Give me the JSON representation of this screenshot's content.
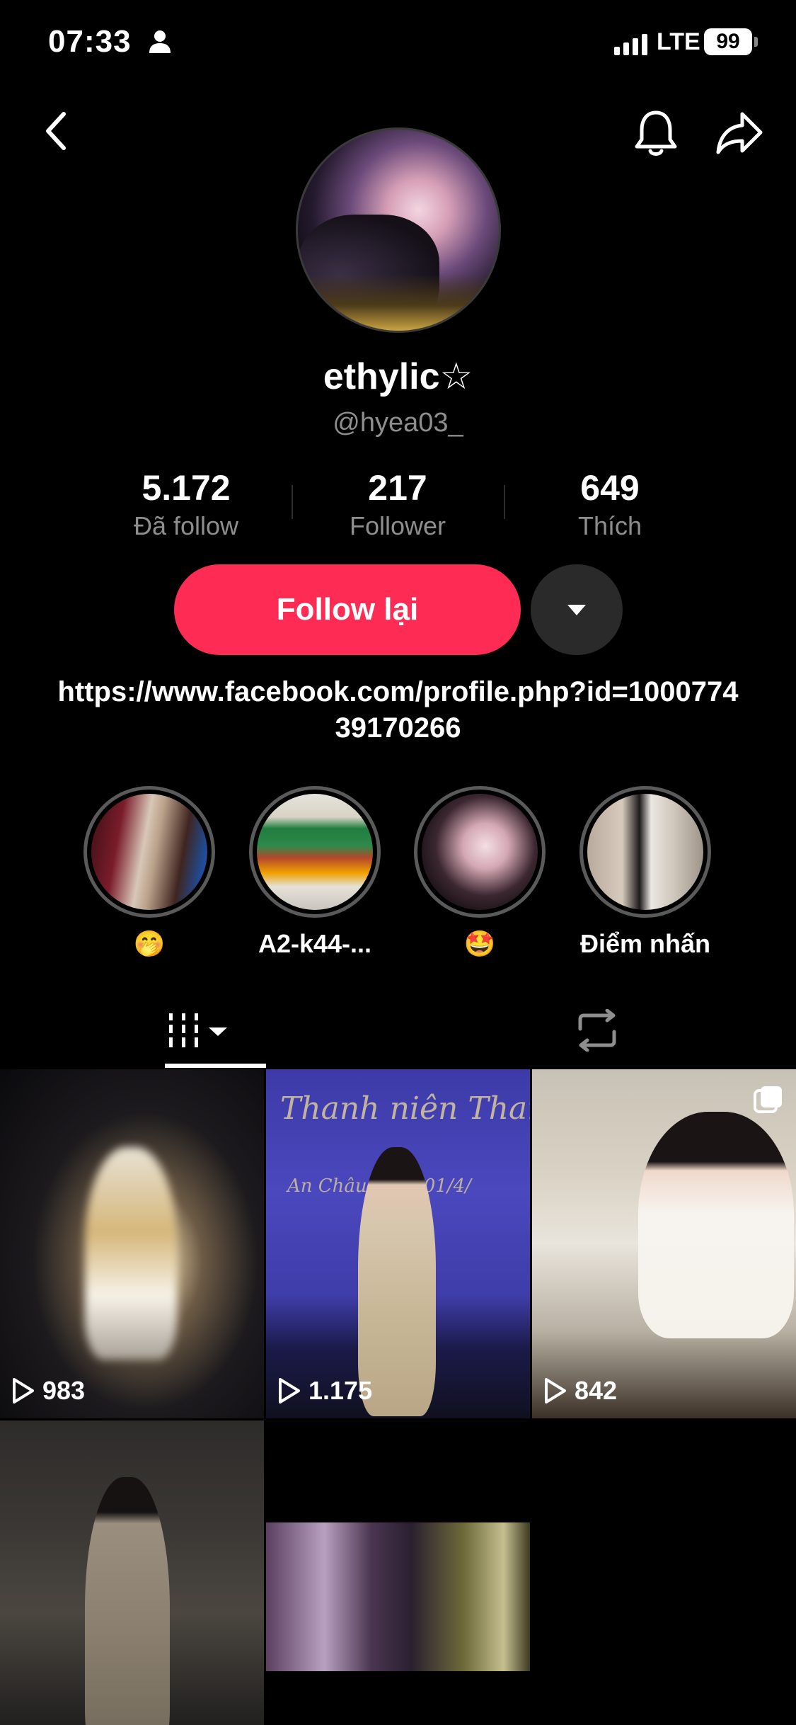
{
  "status_bar": {
    "time": "07:33",
    "network": "LTE",
    "battery": "99"
  },
  "nav": {
    "back_icon": "chevron-left-icon",
    "notification_icon": "bell-icon",
    "share_icon": "share-arrow-icon"
  },
  "profile": {
    "display_name": "ethylic☆",
    "username": "@hyea03_",
    "stats": [
      {
        "value": "5.172",
        "label": "Đã follow"
      },
      {
        "value": "217",
        "label": "Follower"
      },
      {
        "value": "649",
        "label": "Thích"
      }
    ],
    "follow_button": "Follow lại",
    "bio_link": "https://www.facebook.com/profile.php?id=100077439170266"
  },
  "highlights": [
    {
      "label": "🤭"
    },
    {
      "label": "A2-k44-..."
    },
    {
      "label": "🤩"
    },
    {
      "label": "Điểm nhấn"
    }
  ],
  "tabs": {
    "videos_icon": "grid-bars-icon",
    "reposts_icon": "repost-icon"
  },
  "videos": [
    {
      "views": "983"
    },
    {
      "views": "1.175",
      "overlay_text": "Thanh niên Than",
      "overlay_sub": "An Châu  ngày 01/4/"
    },
    {
      "views": "842"
    },
    {},
    {}
  ],
  "colors": {
    "accent": "#fe2c55",
    "background": "#000000",
    "secondary_text": "#8e8e8e"
  }
}
